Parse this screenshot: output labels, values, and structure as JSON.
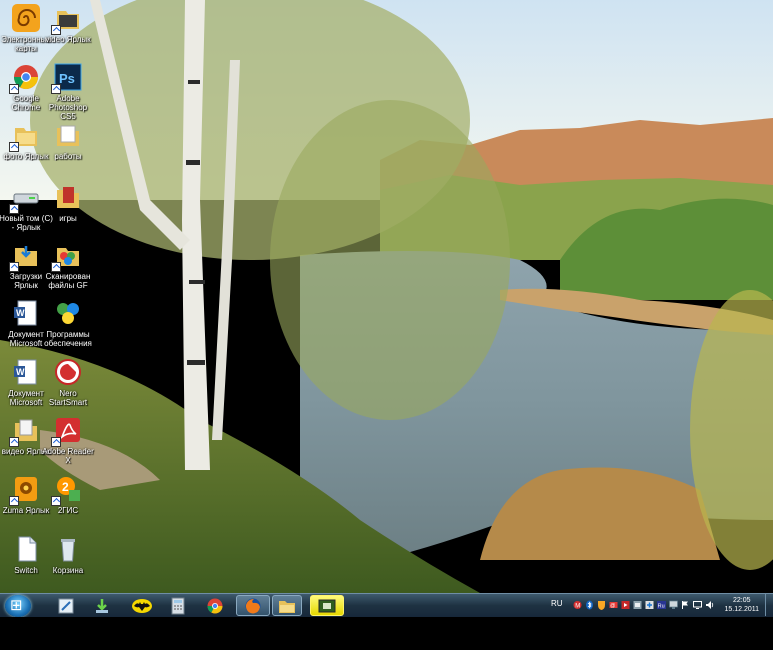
{
  "desktop": {
    "icons": [
      {
        "label": "Электронные карты",
        "icon": "spiral-maps-icon"
      },
      {
        "label": "video Ярлык",
        "icon": "folder-shortcut-icon"
      },
      {
        "label": "Zuma Ярлык",
        "icon": "zuma-game-icon"
      },
      {
        "label": "Adobe Photoshop CS5",
        "icon": "photoshop-icon"
      },
      {
        "label": "фото Ярлык",
        "icon": "folder-shortcut-icon"
      },
      {
        "label": "работы",
        "icon": "folder-icon"
      },
      {
        "label": "Новый том (C) - Ярлык",
        "icon": "drive-icon"
      },
      {
        "label": "игры",
        "icon": "games-folder-icon"
      },
      {
        "label": "Загрузки Ярлык",
        "icon": "downloads-folder-icon"
      },
      {
        "label": "Сканирован файлы GF",
        "icon": "scan-files-icon"
      },
      {
        "label": "Документ Microsoft",
        "icon": "word-document-icon"
      },
      {
        "label": "Программы обеспечения",
        "icon": "programs-icon"
      },
      {
        "label": "Документ Microsoft",
        "icon": "word-document-icon"
      },
      {
        "label": "Nero StartSmart",
        "icon": "nero-icon"
      },
      {
        "label": "видео Ярлык",
        "icon": "video-folder-icon"
      },
      {
        "label": "Adobe Reader X",
        "icon": "adobe-reader-icon"
      },
      {
        "label": "Zuma Ярлык",
        "icon": "zuma-game-icon"
      },
      {
        "label": "2ГИС",
        "icon": "2gis-icon"
      },
      {
        "label": "Switch",
        "icon": "switch-doc-icon"
      },
      {
        "label": "Корзина",
        "icon": "recycle-bin-icon"
      },
      {
        "label": "Google Chrome",
        "icon": "chrome-icon"
      }
    ]
  },
  "taskbar": {
    "language": "RU",
    "clock_time": "22:05",
    "clock_date": "15.12.2011"
  },
  "colors": {
    "taskbar": "#1e3242",
    "start_orb": "#1a6fb3",
    "accent": "#5b9bd5"
  }
}
